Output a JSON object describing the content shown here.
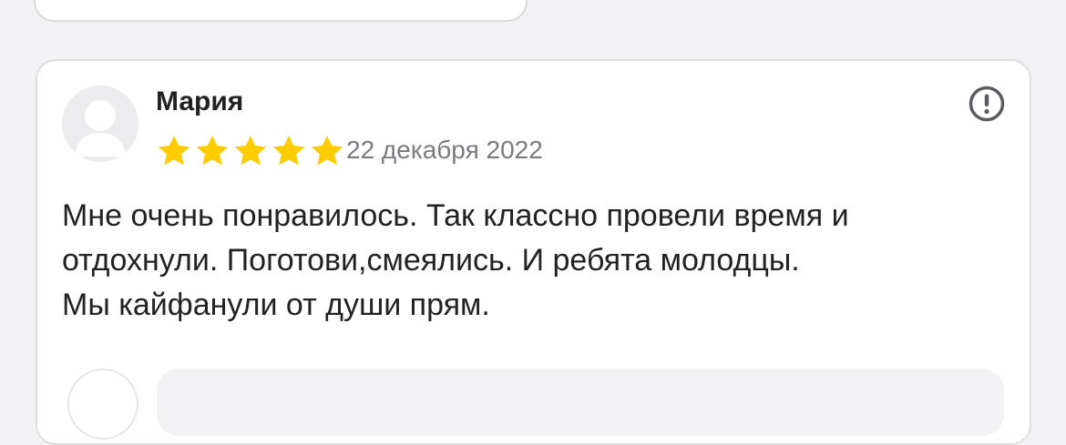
{
  "review": {
    "author": "Мария",
    "rating": 5,
    "date": "22 декабря 2022",
    "text_lines": [
      "Мне очень понравилось. Так классно провели время и",
      "отдохнули. Поготови,смеялись. И ребята молодцы.",
      "Мы кайфанули от души прям."
    ]
  },
  "icons": {
    "avatar": "user-avatar-placeholder-icon",
    "star": "star-icon",
    "report": "exclamation-circle-icon"
  },
  "colors": {
    "star": "#ffcc00",
    "date": "#7a7a80",
    "text": "#222222",
    "background": "#f2f2f4"
  }
}
